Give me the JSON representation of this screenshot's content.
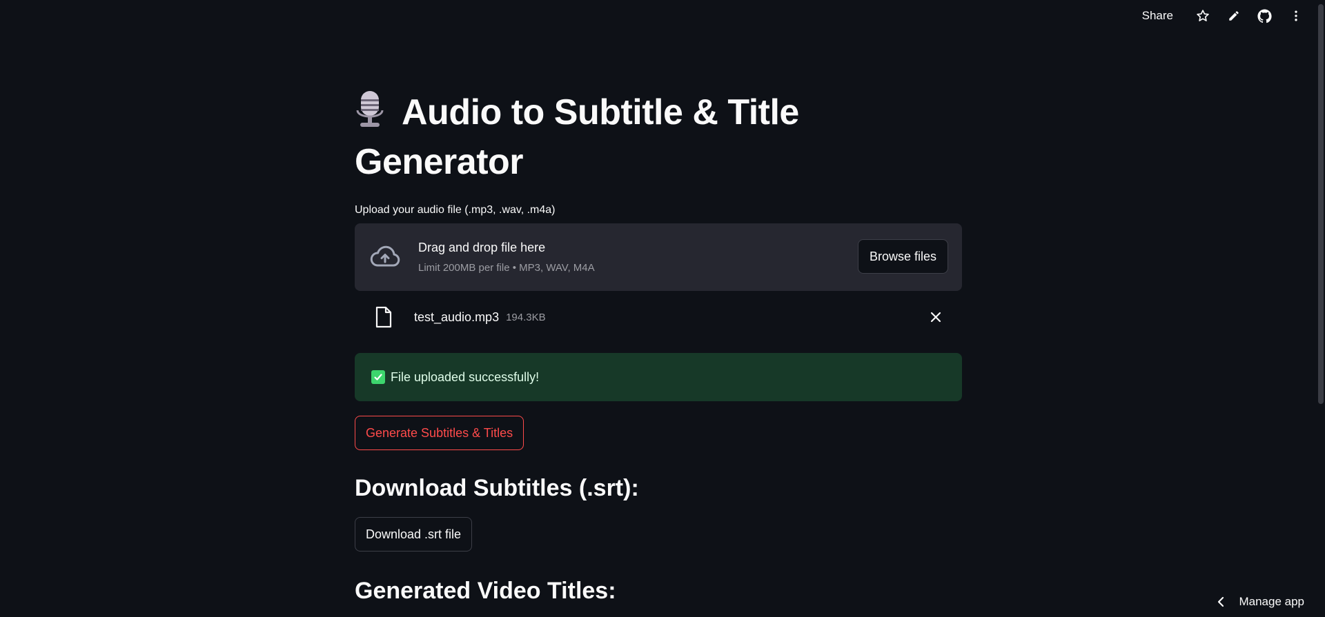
{
  "toolbar": {
    "share_label": "Share",
    "icons": [
      "star-icon",
      "pencil-icon",
      "github-icon",
      "more-vertical-icon"
    ]
  },
  "main": {
    "title_line": "Audio to Subtitle & Title",
    "title_line2": "Generator",
    "title_icon": "microphone-icon",
    "upload": {
      "label": "Upload your audio file (.mp3, .wav, .m4a)",
      "drop_text": "Drag and drop file here",
      "limit_text": "Limit 200MB per file • MP3, WAV, M4A",
      "browse_label": "Browse files"
    },
    "file": {
      "name": "test_audio.mp3",
      "size": "194.3KB"
    },
    "success_message": "File uploaded successfully!",
    "generate_label": "Generate Subtitles & Titles",
    "download_heading": "Download Subtitles (.srt):",
    "download_label": "Download .srt file",
    "titles_heading": "Generated Video Titles:"
  },
  "footer": {
    "manage_app_label": "Manage app"
  },
  "colors": {
    "background": "#0e1117",
    "panel": "#262730",
    "accent": "#ff4b4b",
    "success_bg": "#173928",
    "success_check": "#3dd56d"
  }
}
